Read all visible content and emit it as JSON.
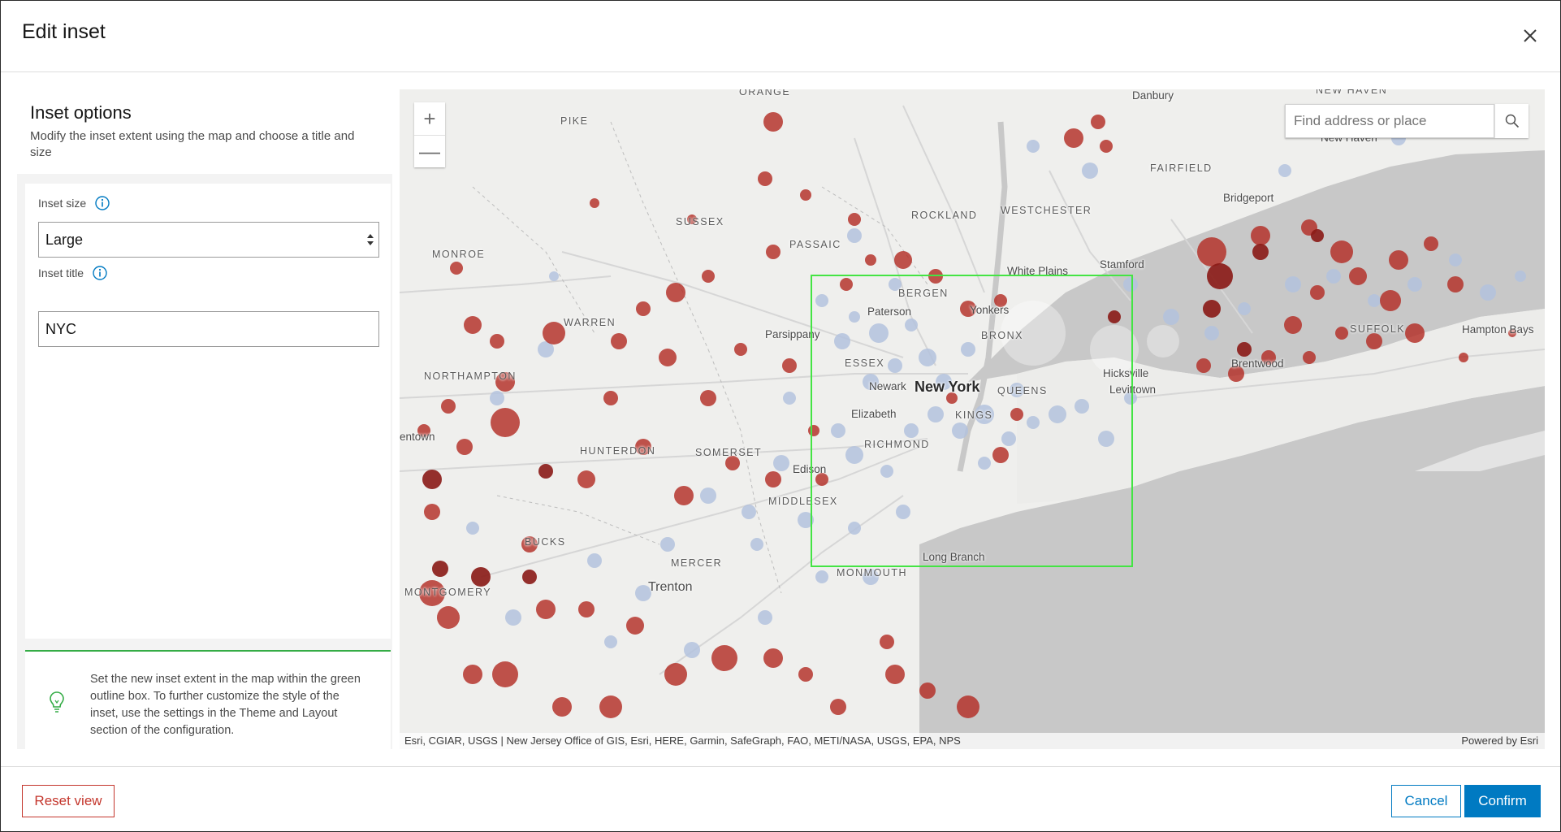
{
  "dialog": {
    "title": "Edit inset"
  },
  "sidebar": {
    "title": "Inset options",
    "description": "Modify the inset extent using the map and choose a title and size",
    "inset_size": {
      "label": "Inset size",
      "value": "Large"
    },
    "inset_title": {
      "label": "Inset title",
      "value": "NYC"
    },
    "tip": "Set the new inset extent in the map within the green outline box. To further customize the style of the inset, use the settings in the Theme and Layout section of the configuration."
  },
  "map": {
    "search": {
      "placeholder": "Find address or place"
    },
    "zoom_in": "+",
    "zoom_out": "—",
    "attribution": "Esri, CGIAR, USGS | New Jersey Office of GIS, Esri, HERE, Garmin, SafeGraph, FAO, METI/NASA, USGS, EPA, NPS",
    "powered_by": "Powered by Esri",
    "inset_outline_color": "#44e444",
    "labels": {
      "orange": "ORANGE",
      "pike": "PIKE",
      "sussex": "SUSSEX",
      "passaic": "PASSAIC",
      "rockland": "ROCKLAND",
      "westchester": "WESTCHESTER",
      "fairfield": "FAIRFIELD",
      "monroe": "MONROE",
      "warren": "WARREN",
      "bergen": "BERGEN",
      "bronx": "BRONX",
      "suffolk": "SUFFOLK",
      "northampton": "NORTHAMPTON",
      "essex": "ESSEX",
      "queens": "QUEENS",
      "kings": "KINGS",
      "hunterdon": "HUNTERDON",
      "somerset": "SOMERSET",
      "richmond": "RICHMOND",
      "middlesex": "MIDDLESEX",
      "bucks": "BUCKS",
      "mercer": "MERCER",
      "monmouth": "MONMOUTH",
      "montgomery": "MONTGOMERY",
      "new_haven": "NEW HAVEN"
    },
    "cities": {
      "danbury": "Danbury",
      "new_haven": "New Haven",
      "bridgeport": "Bridgeport",
      "stamford": "Stamford",
      "white_plains": "White Plains",
      "yonkers": "Yonkers",
      "paterson": "Paterson",
      "parsippany": "Parsippany",
      "newark": "Newark",
      "hicksville": "Hicksville",
      "levittown": "Levittown",
      "brentwood": "Brentwood",
      "hampton_bays": "Hampton Bays",
      "elizabeth": "Elizabeth",
      "edison": "Edison",
      "allentown": "entown",
      "long_branch": "Long Branch",
      "trenton": "Trenton"
    },
    "major_city": "New York"
  },
  "footer": {
    "reset_label": "Reset view",
    "cancel_label": "Cancel",
    "confirm_label": "Confirm"
  },
  "colors": {
    "accent": "#007ac2",
    "danger": "#c4362c",
    "tip_border": "#35ac46",
    "point_high": "#b32a22",
    "point_low": "#b4c3de"
  }
}
